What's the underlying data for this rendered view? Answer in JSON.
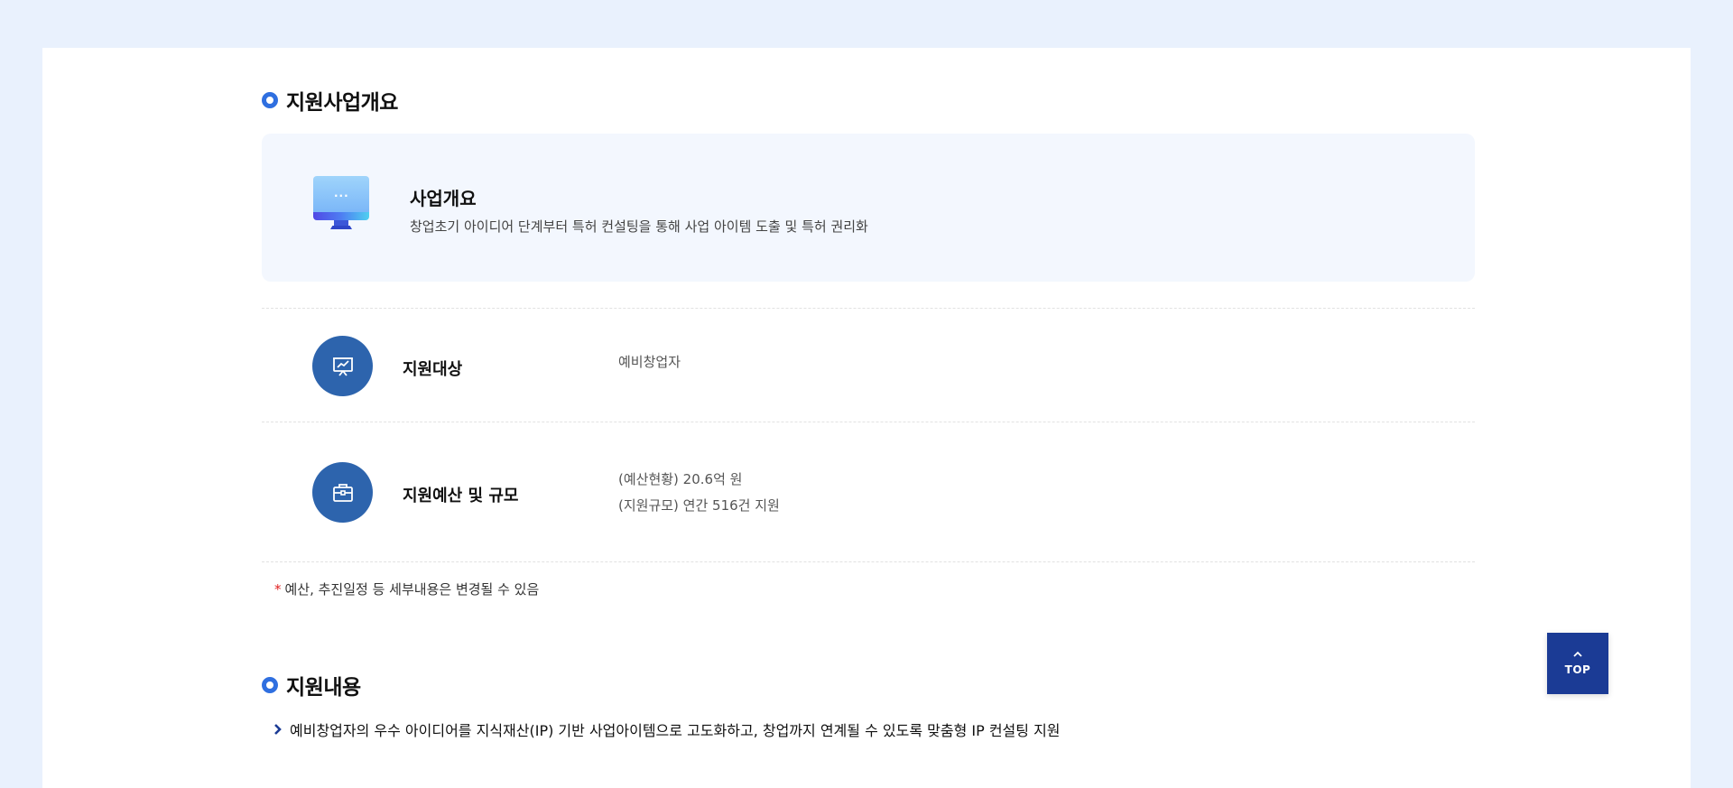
{
  "overview_section": {
    "title": "지원사업개요",
    "overview": {
      "title": "사업개요",
      "description": "창업초기 아이디어 단계부터 특허 컨설팅을 통해 사업 아이템 도출 및 특허 권리화",
      "icon": "monitor-icon"
    },
    "rows": [
      {
        "label": "지원대상",
        "icon": "presentation-chart-icon",
        "values": [
          "예비창업자"
        ]
      },
      {
        "label": "지원예산 및 규모",
        "icon": "briefcase-icon",
        "values": [
          "(예산현황) 20.6억 원",
          "(지원규모) 연간 516건 지원"
        ]
      }
    ],
    "notice_mark": "*",
    "notice": "예산, 추진일정 등 세부내용은 변경될 수 있음"
  },
  "content_section": {
    "title": "지원내용",
    "item": "예비창업자의 우수 아이디어를 지식재산(IP) 기반 사업아이템으로 고도화하고, 창업까지 연계될 수 있도록 맞춤형 IP 컨설팅 지원"
  },
  "top_button": {
    "label": "TOP"
  },
  "colors": {
    "page_bg": "#e9f1fd",
    "accent": "#2f6fe0",
    "icon_circle": "#2d64ad",
    "top_button": "#1b3b95",
    "overview_bg": "#f3f7fe"
  }
}
